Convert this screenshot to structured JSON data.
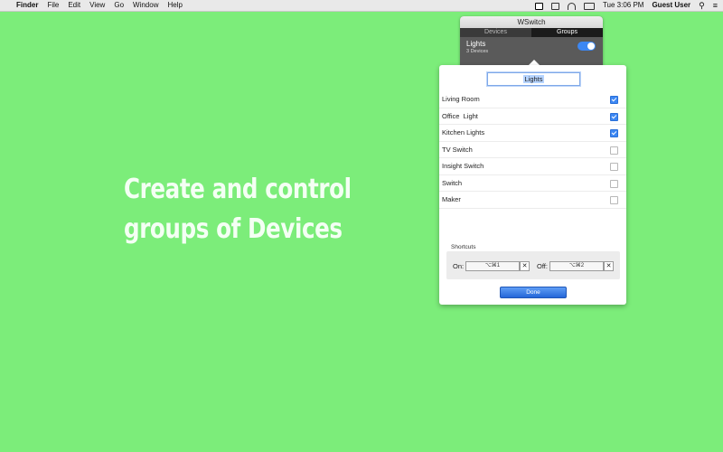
{
  "menubar": {
    "apple_symbol": "",
    "app_name": "Finder",
    "menus": [
      "File",
      "Edit",
      "View",
      "Go",
      "Window",
      "Help"
    ],
    "clock": "Tue 3:06 PM",
    "user": "Guest User",
    "icons": [
      "wswitch-status-icon",
      "airplay-icon",
      "wifi-icon",
      "battery-icon",
      "search-icon",
      "list-icon"
    ]
  },
  "headline": {
    "line1": "Create and control",
    "line2": "groups of Devices"
  },
  "wswitch": {
    "title": "WSwitch",
    "tabs": [
      "Devices",
      "Groups"
    ],
    "active_tab": "Groups",
    "group": {
      "name": "Lights",
      "count": "3 Devices",
      "enabled": true
    }
  },
  "sheet": {
    "group_name": "Lights",
    "devices": [
      {
        "name": "Living Room",
        "checked": true
      },
      {
        "name": "Office  Light",
        "checked": true
      },
      {
        "name": "Kitchen Lights",
        "checked": true
      },
      {
        "name": "TV Switch",
        "checked": false
      },
      {
        "name": "Insight Switch",
        "checked": false
      },
      {
        "name": "Switch",
        "checked": false
      },
      {
        "name": "Maker",
        "checked": false
      }
    ],
    "shortcuts_label": "Shortcuts",
    "on_label": "On:",
    "on_shortcut": "⌥⌘1",
    "off_label": "Off:",
    "off_shortcut": "⌥⌘2",
    "clear_glyph": "✕",
    "done_label": "Done"
  },
  "colors": {
    "background": "#7ced7a",
    "accent": "#3c87f3"
  }
}
